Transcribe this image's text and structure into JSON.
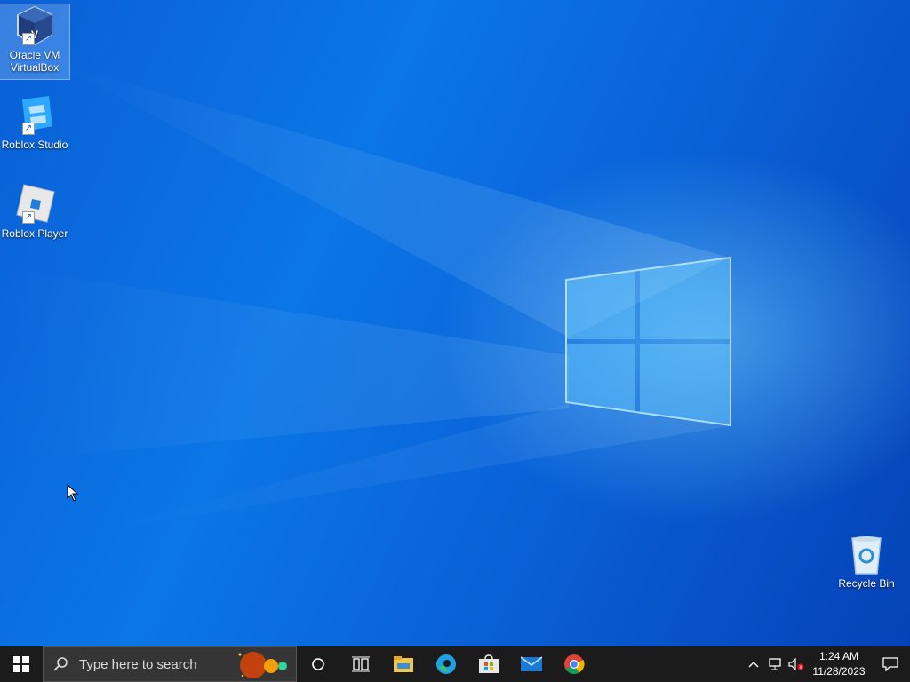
{
  "desktop": {
    "icons": [
      {
        "label_line1": "Oracle VM",
        "label_line2": "VirtualBox",
        "icon": "virtualbox-icon"
      },
      {
        "label": "Roblox Studio",
        "icon": "roblox-studio-icon"
      },
      {
        "label": "Roblox Player",
        "icon": "roblox-player-icon"
      },
      {
        "label": "Recycle Bin",
        "icon": "recycle-bin-icon"
      }
    ]
  },
  "taskbar": {
    "search_placeholder": "Type here to search",
    "pinned_apps": [
      "cortana-icon",
      "task-view-icon",
      "file-explorer-icon",
      "edge-icon",
      "microsoft-store-icon",
      "mail-icon",
      "chrome-icon"
    ],
    "clock": {
      "time": "1:24 AM",
      "date": "11/28/2023"
    }
  },
  "colors": {
    "taskbar": "#1b1b1b",
    "desktop_blue": "#0a6fe0"
  }
}
